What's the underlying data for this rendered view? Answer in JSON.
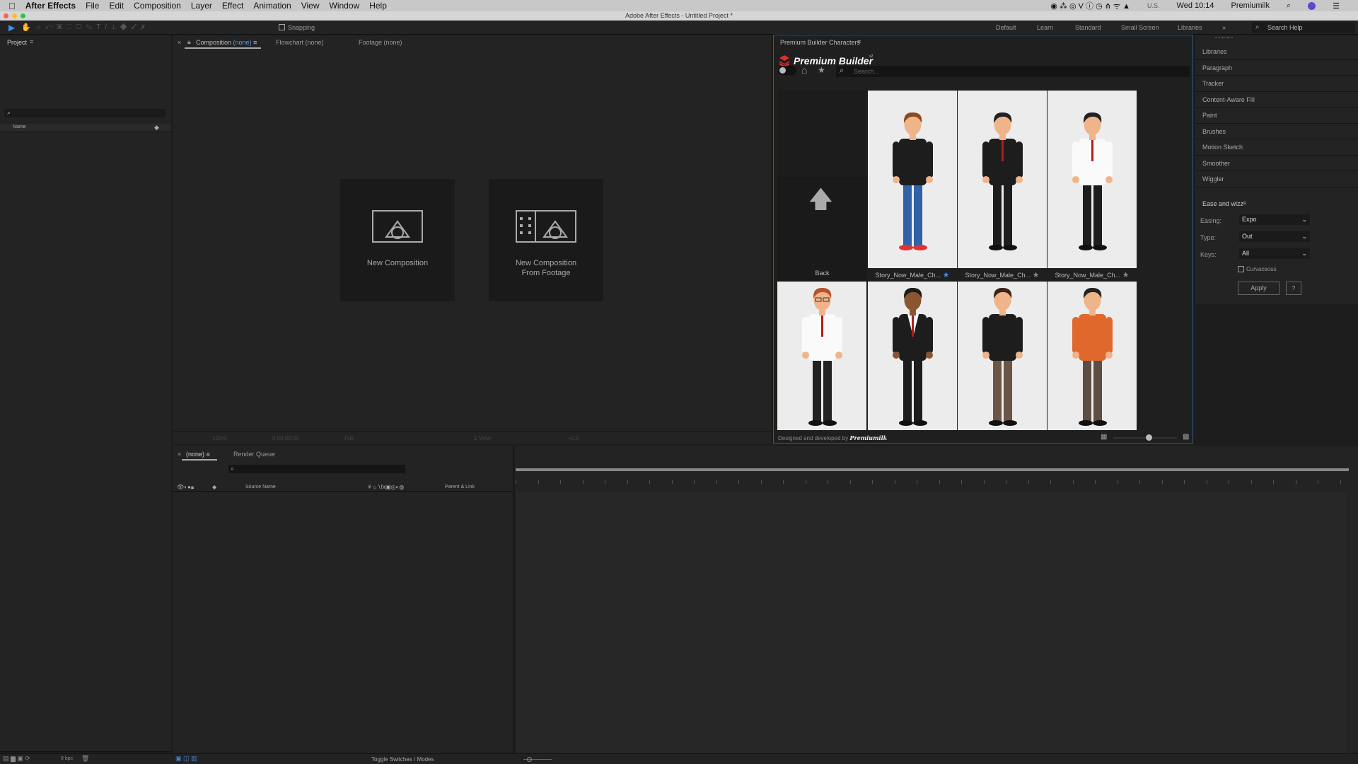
{
  "menubar": {
    "app": "After Effects",
    "items": [
      "File",
      "Edit",
      "Composition",
      "Layer",
      "Effect",
      "Animation",
      "View",
      "Window",
      "Help"
    ],
    "clock": "Wed 10:14",
    "user": "Premiumilk",
    "locale": "U.S."
  },
  "window_title": "Adobe After Effects - Untitled Project *",
  "toolbar": {
    "snapping": "Snapping",
    "workspaces": [
      "Default",
      "Learn",
      "Standard",
      "Small Screen",
      "Libraries"
    ],
    "search_help": "Search Help"
  },
  "project": {
    "title": "Project",
    "col_name": "Name"
  },
  "viewer": {
    "tabs": {
      "composition": "Composition",
      "composition_value": "(none)",
      "flowchart": "Flowchart (none)",
      "footage": "Footage (none)"
    },
    "new_comp": "New Composition",
    "new_comp_footage_1": "New Composition",
    "new_comp_footage_2": "From Footage",
    "zoom": "100%",
    "timecode": "0:00:00:00",
    "resolution": "Full",
    "views": "1 View",
    "exposure": "+0.0"
  },
  "premium": {
    "panel_title": "Premium Builder Characters",
    "brand": "Premium Builder",
    "version": "v2",
    "search_placeholder": "Search...",
    "back": "Back",
    "items": [
      {
        "label": "Story_Now_Male_Ch...",
        "favorite": true
      },
      {
        "label": "Story_Now_Male_Ch...",
        "favorite": false
      },
      {
        "label": "Story_Now_Male_Ch...",
        "favorite": false
      }
    ],
    "footer": "Designed and developed by",
    "footer_logo": "Premiumilk",
    "accent": "#e0302c"
  },
  "right_panel": {
    "items": [
      "Libraries",
      "Paragraph",
      "Tracker",
      "Content-Aware Fill",
      "Paint",
      "Brushes",
      "Motion Sketch",
      "Smoother",
      "Wiggler"
    ]
  },
  "ease": {
    "title": "Ease and wizz",
    "easing_label": "Easing:",
    "easing": "Expo",
    "type_label": "Type:",
    "type": "Out",
    "keys_label": "Keys:",
    "keys": "All",
    "curvaceous": "Curvaceous",
    "curvaceous_checked": false,
    "apply": "Apply",
    "help": "?"
  },
  "timeline": {
    "tab": "(none)",
    "render_queue": "Render Queue",
    "source_name": "Source Name",
    "parent_link": "Parent & Link",
    "toggle": "Toggle Switches / Modes",
    "bpc": "8 bpc"
  }
}
